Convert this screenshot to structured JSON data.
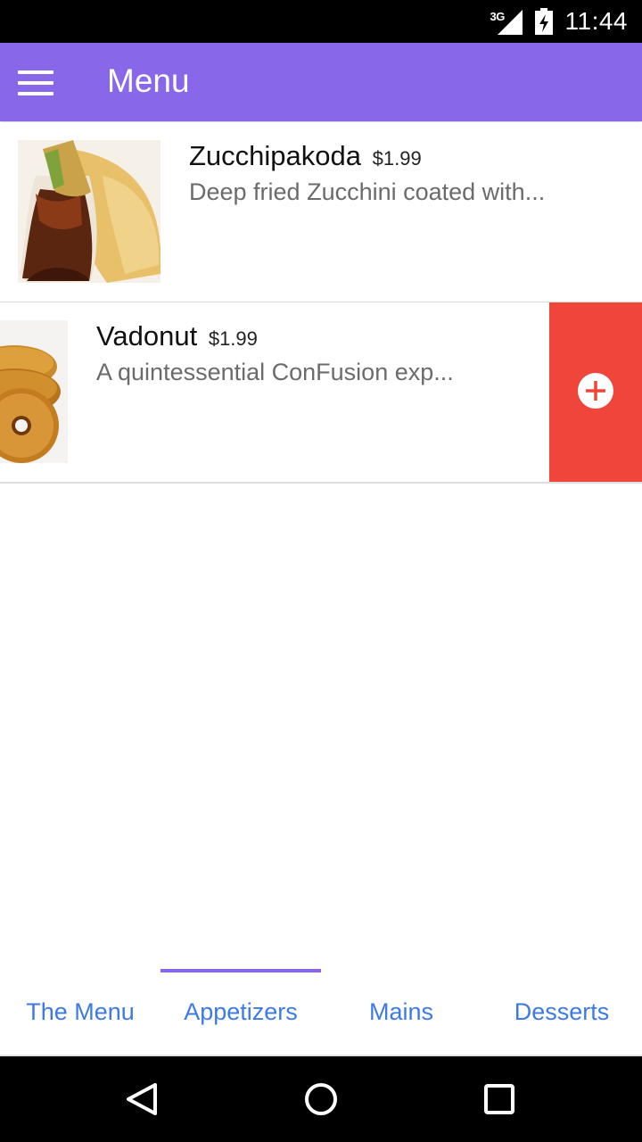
{
  "status_bar": {
    "network": "3G",
    "time": "11:44",
    "icons": [
      "signal-icon",
      "battery-charging-icon"
    ]
  },
  "app_bar": {
    "title": "Menu",
    "menu_icon": "hamburger-menu-icon"
  },
  "menu_items": [
    {
      "name": "Zucchipakoda",
      "price": "$1.99",
      "description": "Deep fried Zucchini coated with..."
    },
    {
      "name": "Vadonut",
      "price": "$1.99",
      "description": "A quintessential ConFusion exp...",
      "swipe_action_icon": "add-circle-icon"
    }
  ],
  "tabs": [
    {
      "label": "The Menu",
      "selected": false
    },
    {
      "label": "Appetizers",
      "selected": true
    },
    {
      "label": "Mains",
      "selected": false
    },
    {
      "label": "Desserts",
      "selected": false
    }
  ],
  "colors": {
    "primary": "#8867e8",
    "tab_text": "#3d7ae6",
    "swipe_action": "#f0453a"
  },
  "nav_bar": {
    "icons": [
      "back-icon",
      "home-icon",
      "recents-icon"
    ]
  }
}
